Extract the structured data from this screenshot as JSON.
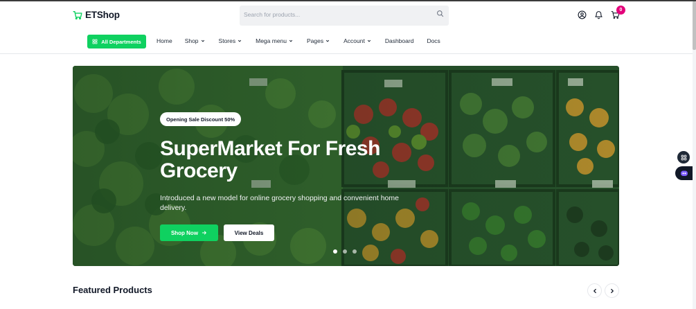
{
  "header": {
    "brand": "ETShop",
    "search_placeholder": "Search  for products...",
    "cart_count": "0"
  },
  "nav": {
    "all_departments": "All Departments",
    "items": [
      {
        "label": "Home",
        "dropdown": false
      },
      {
        "label": "Shop",
        "dropdown": true
      },
      {
        "label": "Stores",
        "dropdown": true
      },
      {
        "label": "Mega menu",
        "dropdown": true
      },
      {
        "label": "Pages",
        "dropdown": true
      },
      {
        "label": "Account",
        "dropdown": true
      },
      {
        "label": "Dashboard",
        "dropdown": false
      },
      {
        "label": "Docs",
        "dropdown": false
      }
    ]
  },
  "hero": {
    "badge": "Opening Sale Discount 50%",
    "title": "SuperMarket For Fresh Grocery",
    "description": "Introduced a new model for online grocery shopping and convenient home delivery.",
    "primary_button": "Shop Now",
    "secondary_button": "View Deals",
    "slide_count": 3,
    "active_slide": 1
  },
  "featured": {
    "title": "Featured Products"
  },
  "colors": {
    "accent": "#0fd160",
    "badge": "#e3007a",
    "text": "#111827"
  },
  "icons": {
    "logo": "cart-icon",
    "search": "search-icon",
    "account": "user-icon",
    "notifications": "bell-icon",
    "cart": "cart-icon"
  }
}
